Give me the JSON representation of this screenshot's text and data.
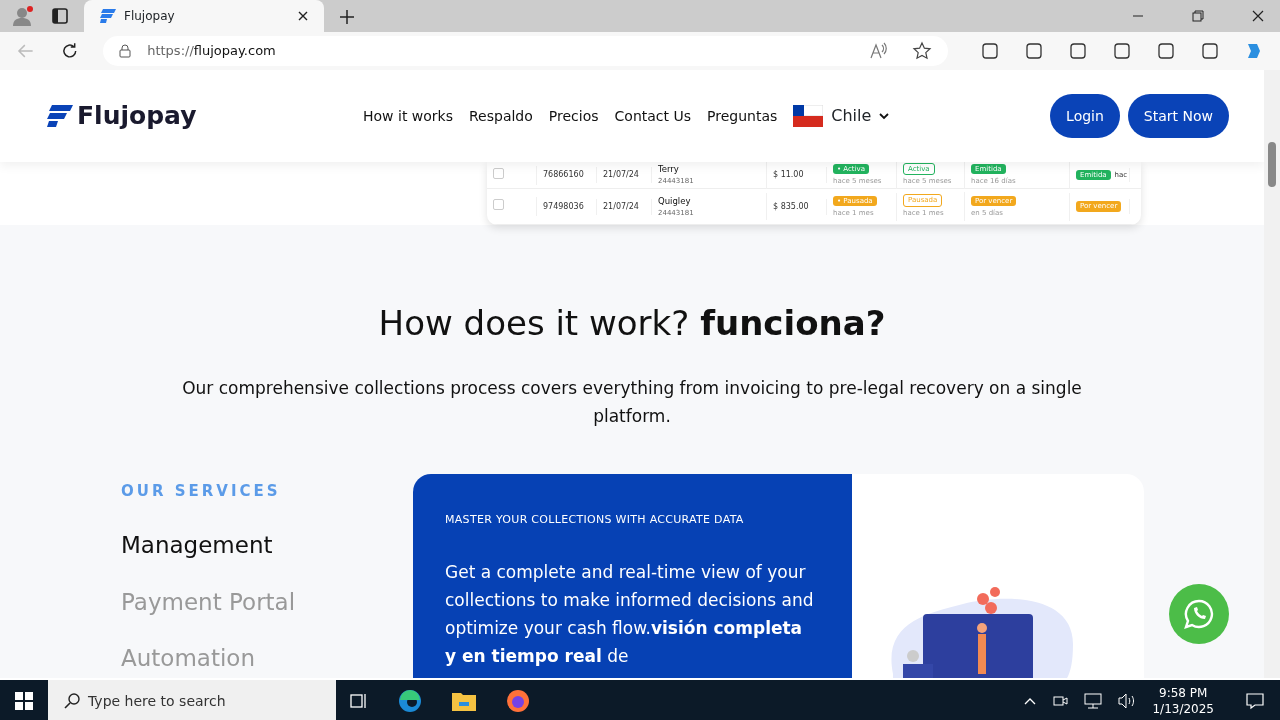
{
  "browser": {
    "tab_title": "Flujopay",
    "url_scheme": "https://",
    "url_host": "flujopay.com"
  },
  "header": {
    "logo": "Flujopay",
    "nav": [
      "How it works",
      "Respaldo",
      "Precios",
      "Contact Us",
      "Preguntas"
    ],
    "country": "Chile",
    "buttons": [
      {
        "label": "Login"
      },
      {
        "label": "Start Now"
      }
    ]
  },
  "table": {
    "rows": [
      {
        "checked": false,
        "id": "76866160",
        "date": "21/07/24",
        "name": "Terry",
        "sub": "24443181",
        "amount": "$ 11.00",
        "badges": [
          {
            "label": "• Activa",
            "note": "hace 5 meses",
            "kind": "solid",
            "color": "#22b35e"
          },
          {
            "label": "Activa",
            "note": "hace 5 meses",
            "kind": "soft",
            "color": "#22b35e"
          },
          {
            "label": "Emitida",
            "note": "hace 16 días",
            "kind": "solid",
            "color": "#22b35e"
          },
          {
            "label": "Emitida",
            "note": "hac",
            "kind": "solid",
            "color": "#22b35e"
          }
        ]
      },
      {
        "checked": false,
        "id": "97498036",
        "date": "21/07/24",
        "name": "Quigley",
        "sub": "24443181",
        "amount": "$ 835.00",
        "badges": [
          {
            "label": "• Pausada",
            "note": "hace 1 mes",
            "kind": "solid",
            "color": "#f2a81d"
          },
          {
            "label": "Pausada",
            "note": "hace 1 mes",
            "kind": "soft",
            "color": "#f2a81d"
          },
          {
            "label": "Por vencer",
            "note": "en 5 días",
            "kind": "solid",
            "color": "#f2a81d"
          },
          {
            "label": "Por vencer",
            "kind": "solid",
            "color": "#f2a81d"
          }
        ]
      }
    ]
  },
  "section": {
    "heading": "How does it work? **funciona?**",
    "intro": "Our comprehensive collections process covers everything from invoicing to pre-legal recovery on a single platform.",
    "services_label": "OUR SERVICES",
    "services": [
      {
        "label": "Management",
        "selected": true
      },
      {
        "label": "Payment Portal",
        "selected": false
      },
      {
        "label": "Automation",
        "selected": false
      }
    ],
    "card": {
      "eyebrow": "MASTER YOUR COLLECTIONS WITH ACCURATE DATA",
      "text": "Get a complete and real-time view of your collections to make informed decisions and optimize your cash flow.**visión completa y en tiempo real** de"
    }
  },
  "taskbar": {
    "search_placeholder": "Type here to search",
    "time": "9:58 PM",
    "date": "1/13/2025"
  }
}
